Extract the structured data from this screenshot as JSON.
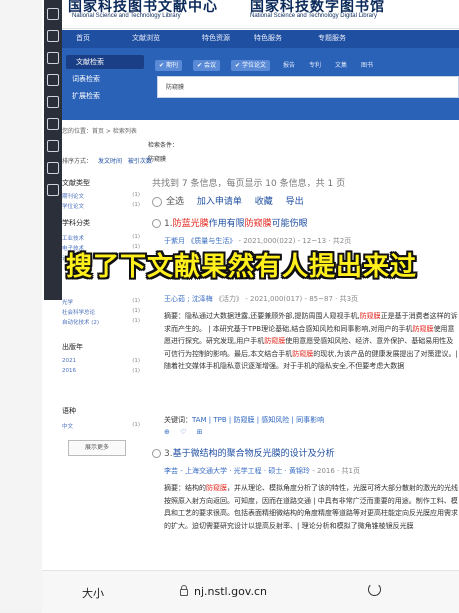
{
  "header": {
    "logo_cn_1": "国家科技图书文献中心",
    "logo_en_1": "National Science and Technology Library",
    "logo_cn_2": "国家科技数字图书馆",
    "logo_en_2": "National Science and Technology Digital Library"
  },
  "nav": [
    "首页",
    "文献浏览",
    "特色资源",
    "特色服务",
    "专题服务"
  ],
  "left_menu": [
    "文献检索",
    "词表检索",
    "扩展检索"
  ],
  "search_tabs": [
    "期刊",
    "会议",
    "学位论文",
    "报告",
    "专利",
    "文集",
    "图书"
  ],
  "search": {
    "query": "防窥膜"
  },
  "breadcrumb": "您的位置：首页 > 检索列表",
  "condition_label": "检索条件：",
  "condition_value": "防窥膜",
  "sort": {
    "label": "排序方式：",
    "opt1": "发文时间",
    "opt2": "被引次数"
  },
  "filters": {
    "doc_type_head": "文献类型",
    "doc_types": [
      {
        "label": "期刊论文",
        "count": "(1)"
      },
      {
        "label": "学位论文",
        "count": "(1)"
      }
    ],
    "subject_head": "学科分类",
    "subjects": [
      {
        "label": "工业技术",
        "count": "(1)"
      },
      {
        "label": "电子技术",
        "count": "(1)"
      },
      {
        "label": "计算机技术",
        "count": "(1)"
      },
      {
        "label": "光学",
        "count": "(1)"
      },
      {
        "label": "社会科学总论",
        "count": "(1)"
      },
      {
        "label": "自动化技术 (2)",
        "count": "(1)"
      }
    ],
    "year_head": "出版年",
    "years": [
      {
        "label": "2021",
        "count": "(1)"
      },
      {
        "label": "2016",
        "count": "(1)"
      }
    ],
    "lang_head": "语种",
    "langs": [
      {
        "label": "中文",
        "count": "(1)"
      }
    ],
    "more_label": "展示更多"
  },
  "summary": "共找到 7 条信息，每页显示 10 条信息，共 1 页",
  "actions": {
    "select_all": "全选",
    "add_list": "加入申请单",
    "collect": "收藏",
    "export": "导出"
  },
  "overlay_text": "搜了下文献果然有人提出来过",
  "results": [
    {
      "num": "1.",
      "pre": "",
      "hl": "防蓝光膜",
      "mid": "作用有限",
      "hl2": "防窥膜",
      "post": "可能伤眼",
      "meta": "于紫月",
      "meta_source": "《质量与生活》",
      "meta_tail": "- 2021,000(022) - 12~13 · 共2页"
    },
    {
      "num": "2.",
      "meta": "王心茹",
      "meta_source": "沈泽梅",
      "meta_tail": "《活力》 - 2021,000(017) - 85~87 · 共3页",
      "abstract_pre": "摘要：隐私通过大数据泄露,还要兼顾外部,提防周围人窥视手机,",
      "abstract_hl1": "防窥膜",
      "abstract_mid": "正是基于消费者这样的诉求而产生的。 | 本研究基于TPB理论基础,结合感知风险和同事影响,对用户的手机",
      "abstract_hl2": "防窥膜",
      "abstract_mid2": "使用意愿进行探究。研究发现,用户手机",
      "abstract_hl3": "防窥膜",
      "abstract_mid3": "使用意愿受感知风险、经济、意外保护、基础易用性及可信行为控制的影响。最后,本文结合手机",
      "abstract_hl4": "防窥膜",
      "abstract_tail": "的现状,为该产品的健康发展提出了对策建议。| 随着社交媒体手机隐私意识逐渐增强。对于手机的隐私安全,不但要考虑大数据",
      "keywords_label": "关键词：",
      "keywords": "TAM | TPB | 防窥膜 | 感知风险 | 同事影响"
    },
    {
      "num": "3.",
      "title": "基于微结构的聚合物反光膜的设计及分析",
      "meta": "李芸",
      "meta_source": "上海交通大学 · 光学工程 · 硕士 · 黄锦玲",
      "meta_tail": "- 2016 · 共1页",
      "abstract_pre": "摘要：结构的",
      "abstract_hl1": "防窥膜",
      "abstract_tail": "，并从理论、模拟角度分析了该的特性，光膜可将大部分散射的激光的光线按照原入射方向返回。可知度，因而在道路交通 | 中具有非常广泛而重要的用途。制作工料、模具和工艺的要求很高。包括表面精细微结构的角度精度等道路等对更高柱能定向反光膜应用需求的扩大。迫切需要研究设计以提高反射率、| 理论分析和模拟了微角锥棱镜反光膜"
    }
  ],
  "browser": {
    "text_size": "大小",
    "url": "nj.nstl.gov.cn"
  }
}
